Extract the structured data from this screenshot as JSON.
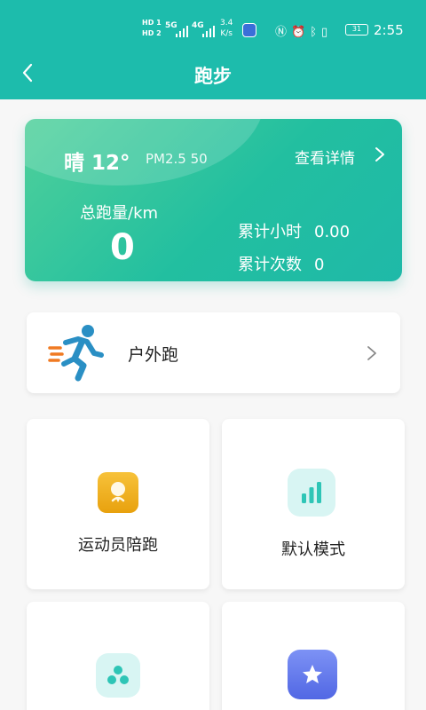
{
  "status_bar": {
    "hd1": "HD 1",
    "hd2": "HD 2",
    "net1": "5G",
    "net2": "4G",
    "speed_value": "3.4",
    "speed_unit": "K/s",
    "battery": "31",
    "time": "2:55",
    "system_icons": [
      "nfc-icon",
      "alarm-icon",
      "bluetooth-icon",
      "vibrate-icon"
    ]
  },
  "header": {
    "title": "跑步"
  },
  "summary_card": {
    "weather": "晴 12°",
    "pm25": "PM2.5 50",
    "detail_link": "查看详情",
    "total_label": "总跑量/km",
    "total_value": "0",
    "hours_label": "累计小时",
    "hours_value": "0.00",
    "count_label": "累计次数",
    "count_value": "0"
  },
  "outdoor": {
    "label": "户外跑",
    "icon": "runner-icon"
  },
  "modes": [
    {
      "label": "运动员陪跑",
      "icon": "athlete-icon",
      "color": "#f0b020"
    },
    {
      "label": "默认模式",
      "icon": "bar-chart-icon",
      "color": "#2ec5b6"
    },
    {
      "label": "",
      "icon": "share-nodes-icon",
      "color": "#2ec5b6"
    },
    {
      "label": "",
      "icon": "star-icon",
      "color": "#5a6fe8"
    }
  ],
  "colors": {
    "primary": "#1dbcac",
    "card_gradient_start": "#4fd09a",
    "card_gradient_end": "#1fb9a8",
    "runner_blue": "#2a8fc4",
    "runner_orange": "#f07a22"
  }
}
